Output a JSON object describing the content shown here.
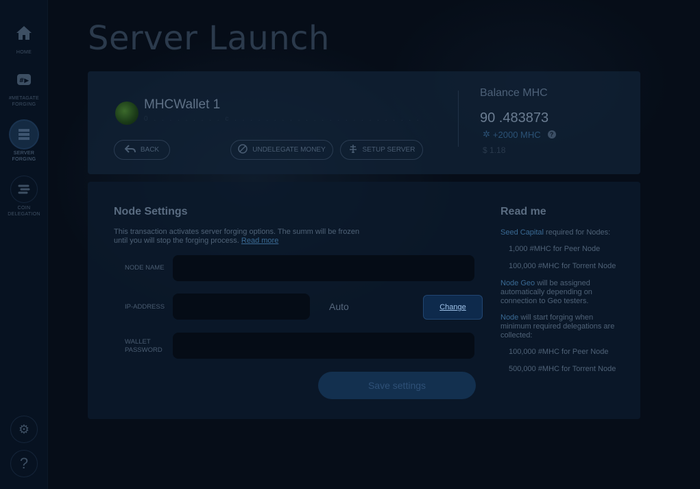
{
  "sidebar": {
    "items": [
      {
        "label": "HOME",
        "icon": "home-icon"
      },
      {
        "label": "#METAGATE FORGING",
        "icon": "metagate-icon"
      },
      {
        "label": "SERVER FORGING",
        "icon": "server-icon",
        "active": true
      },
      {
        "label": "COIN DELEGATION",
        "icon": "coin-icon"
      }
    ],
    "settings_icon": "gear-icon",
    "help_label": "?"
  },
  "page": {
    "title": "Server Launch"
  },
  "wallet": {
    "name": "MHCWallet 1",
    "address": "0 . . . . . . . . . c . . . . . . . . . . . . . . . . . . . . . . . . . . . . . . . . . . . . . . . . . 0 . . . . . . . . . . . c . . . . . . . . . . . . . 6 0 0",
    "back_label": "BACK",
    "undelegate_label": "UNDELEGATE MONEY",
    "setup_label": "SETUP SERVER",
    "balance_label": "Balance MHC",
    "balance_value": "90 .483873",
    "bonus": "+2000 MHC",
    "usd": "$ 1.18"
  },
  "node_settings": {
    "title": "Node Settings",
    "description": "This transaction activates server forging options. The summ will be frozen until you will stop the forging process.",
    "read_more": "Read more",
    "node_name_label": "NODE NAME",
    "node_name_value": "",
    "ip_label": "IP-ADDRESS",
    "ip_value": "",
    "auto_label": "Auto",
    "change_label": "Change",
    "password_label_1": "WALLET",
    "password_label_2": "PASSWORD",
    "password_value": "",
    "save_label": "Save settings"
  },
  "readme": {
    "title": "Read me",
    "seed_hl": "Seed Capital",
    "seed_text": " required for Nodes:",
    "seed_items": [
      "1,000 #MHC for Peer Node",
      "100,000 #MHC for Torrent Node"
    ],
    "geo_hl": "Node Geo",
    "geo_text": " will be assigned automatically depending on connection to Geo testers.",
    "node_hl": "Node",
    "node_text": " will start forging when minimum required delegations are collected:",
    "node_items": [
      "100,000 #MHC for Peer Node",
      "500,000 #MHC for Torrent Node"
    ]
  },
  "colors": {
    "background": "#060d18",
    "accent": "#3a6a94",
    "change_button": "#0e2a4c"
  }
}
